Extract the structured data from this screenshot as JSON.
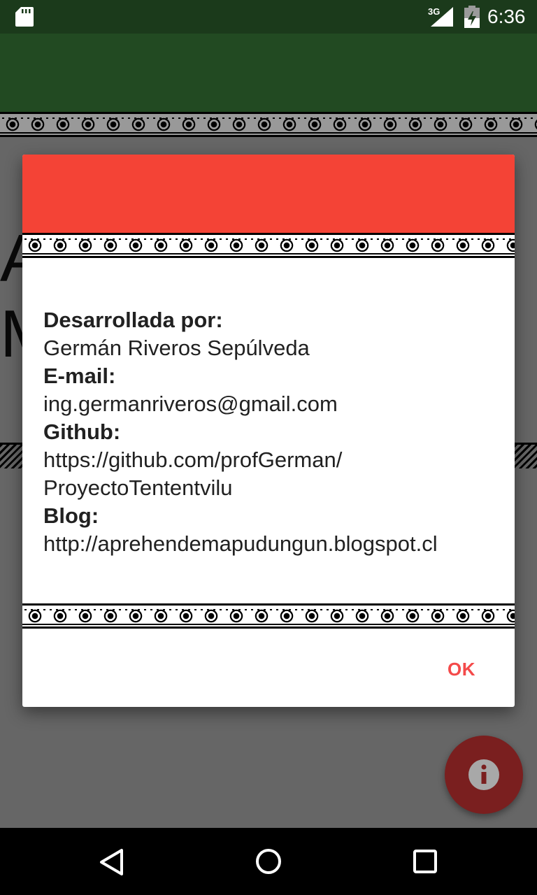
{
  "status_bar": {
    "network": "3G",
    "time": "6:36",
    "icons": [
      "sd-card-icon",
      "signal-icon",
      "battery-icon"
    ]
  },
  "background": {
    "letters": [
      "A",
      "M"
    ]
  },
  "dialog": {
    "header_color": "#f44336",
    "fields": [
      {
        "label": "Desarrollada por:",
        "value": "Germán Riveros Sepúlveda"
      },
      {
        "label": "E-mail:",
        "value": "ing.germanriveros@gmail.com"
      },
      {
        "label": "Github:",
        "value": "https://github.com/profGerman/ ProyectoTententvilu"
      },
      {
        "label": "Blog:",
        "value": "http://aprehendemapudungun.blogspot.cl"
      }
    ],
    "ok_label": "OK"
  },
  "fab": {
    "icon": "info-icon",
    "color": "#7a1f1f"
  },
  "nav_bar": {
    "icons": [
      "back-icon",
      "home-icon",
      "recents-icon"
    ]
  },
  "colors": {
    "app_bar": "#224a22",
    "status_bar": "#1b3a1b",
    "accent": "#f44a4a"
  }
}
